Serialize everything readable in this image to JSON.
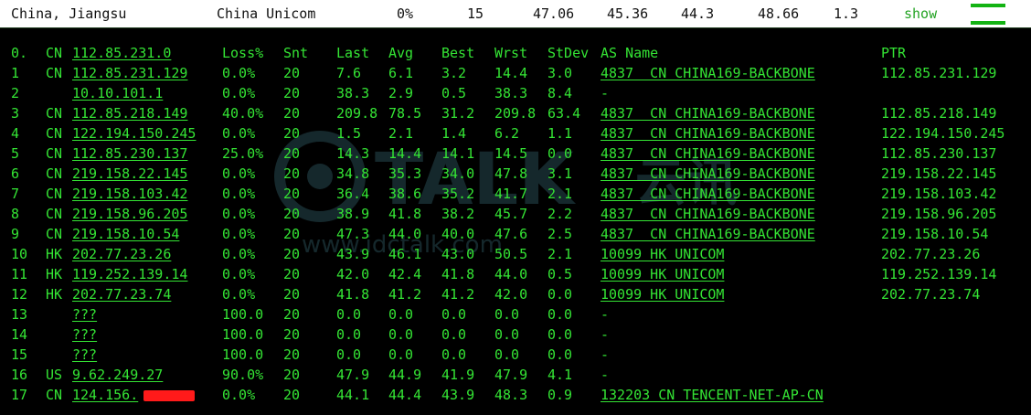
{
  "summary": {
    "location": "China, Jiangsu",
    "isp": "China Unicom",
    "loss": "0%",
    "snt": "15",
    "last": "47.06",
    "avg": "45.36",
    "best": "44.3",
    "wrst": "48.66",
    "stdev": "1.3",
    "show_label": "show"
  },
  "header": {
    "hop": "0.",
    "cc": "CN",
    "host": "112.85.231.0",
    "loss": "Loss%",
    "snt": "Snt",
    "last": "Last",
    "avg": "Avg",
    "best": "Best",
    "wrst": "Wrst",
    "stdev": "StDev",
    "asn": "AS Name",
    "ptr": "PTR"
  },
  "rows": [
    {
      "hop": "1",
      "cc": "CN",
      "host": "112.85.231.129",
      "loss": "0.0%",
      "snt": "20",
      "last": "7.6",
      "avg": "6.1",
      "best": "3.2",
      "wrst": "14.4",
      "stdev": "3.0",
      "asn": "4837  CN CHINA169-BACKBONE",
      "ptr": "112.85.231.129"
    },
    {
      "hop": "2",
      "cc": "",
      "host": "10.10.101.1",
      "loss": "0.0%",
      "snt": "20",
      "last": "38.3",
      "avg": "2.9",
      "best": "0.5",
      "wrst": "38.3",
      "stdev": "8.4",
      "asn": "-",
      "ptr": ""
    },
    {
      "hop": "3",
      "cc": "CN",
      "host": "112.85.218.149",
      "loss": "40.0%",
      "snt": "20",
      "last": "209.8",
      "avg": "78.5",
      "best": "31.2",
      "wrst": "209.8",
      "stdev": "63.4",
      "asn": "4837  CN CHINA169-BACKBONE",
      "ptr": "112.85.218.149"
    },
    {
      "hop": "4",
      "cc": "CN",
      "host": "122.194.150.245",
      "loss": "0.0%",
      "snt": "20",
      "last": "1.5",
      "avg": "2.1",
      "best": "1.4",
      "wrst": "6.2",
      "stdev": "1.1",
      "asn": "4837  CN CHINA169-BACKBONE",
      "ptr": "122.194.150.245"
    },
    {
      "hop": "5",
      "cc": "CN",
      "host": "112.85.230.137",
      "loss": "25.0%",
      "snt": "20",
      "last": "14.3",
      "avg": "14.4",
      "best": "14.1",
      "wrst": "14.5",
      "stdev": "0.0",
      "asn": "4837  CN CHINA169-BACKBONE",
      "ptr": "112.85.230.137"
    },
    {
      "hop": "6",
      "cc": "CN",
      "host": "219.158.22.145",
      "loss": "0.0%",
      "snt": "20",
      "last": "34.8",
      "avg": "35.3",
      "best": "34.0",
      "wrst": "47.8",
      "stdev": "3.1",
      "asn": "4837  CN CHINA169-BACKBONE",
      "ptr": "219.158.22.145"
    },
    {
      "hop": "7",
      "cc": "CN",
      "host": "219.158.103.42",
      "loss": "0.0%",
      "snt": "20",
      "last": "36.4",
      "avg": "38.6",
      "best": "35.2",
      "wrst": "41.7",
      "stdev": "2.1",
      "asn": "4837  CN CHINA169-BACKBONE",
      "ptr": "219.158.103.42"
    },
    {
      "hop": "8",
      "cc": "CN",
      "host": "219.158.96.205",
      "loss": "0.0%",
      "snt": "20",
      "last": "38.9",
      "avg": "41.8",
      "best": "38.2",
      "wrst": "45.7",
      "stdev": "2.2",
      "asn": "4837  CN CHINA169-BACKBONE",
      "ptr": "219.158.96.205"
    },
    {
      "hop": "9",
      "cc": "CN",
      "host": "219.158.10.54",
      "loss": "0.0%",
      "snt": "20",
      "last": "47.3",
      "avg": "44.0",
      "best": "40.0",
      "wrst": "47.6",
      "stdev": "2.5",
      "asn": "4837  CN CHINA169-BACKBONE",
      "ptr": "219.158.10.54"
    },
    {
      "hop": "10",
      "cc": "HK",
      "host": "202.77.23.26",
      "loss": "0.0%",
      "snt": "20",
      "last": "43.9",
      "avg": "46.1",
      "best": "43.0",
      "wrst": "50.5",
      "stdev": "2.1",
      "asn": "10099 HK UNICOM",
      "ptr": "202.77.23.26"
    },
    {
      "hop": "11",
      "cc": "HK",
      "host": "119.252.139.14",
      "loss": "0.0%",
      "snt": "20",
      "last": "42.0",
      "avg": "42.4",
      "best": "41.8",
      "wrst": "44.0",
      "stdev": "0.5",
      "asn": "10099 HK UNICOM",
      "ptr": "119.252.139.14"
    },
    {
      "hop": "12",
      "cc": "HK",
      "host": "202.77.23.74",
      "loss": "0.0%",
      "snt": "20",
      "last": "41.8",
      "avg": "41.2",
      "best": "41.2",
      "wrst": "42.0",
      "stdev": "0.0",
      "asn": "10099 HK UNICOM",
      "ptr": "202.77.23.74"
    },
    {
      "hop": "13",
      "cc": "",
      "host": "???",
      "loss": "100.0",
      "snt": "20",
      "last": "0.0",
      "avg": "0.0",
      "best": "0.0",
      "wrst": "0.0",
      "stdev": "0.0",
      "asn": "-",
      "ptr": ""
    },
    {
      "hop": "14",
      "cc": "",
      "host": "???",
      "loss": "100.0",
      "snt": "20",
      "last": "0.0",
      "avg": "0.0",
      "best": "0.0",
      "wrst": "0.0",
      "stdev": "0.0",
      "asn": "-",
      "ptr": ""
    },
    {
      "hop": "15",
      "cc": "",
      "host": "???",
      "loss": "100.0",
      "snt": "20",
      "last": "0.0",
      "avg": "0.0",
      "best": "0.0",
      "wrst": "0.0",
      "stdev": "0.0",
      "asn": "-",
      "ptr": ""
    },
    {
      "hop": "16",
      "cc": "US",
      "host": "9.62.249.27",
      "loss": "90.0%",
      "snt": "20",
      "last": "47.9",
      "avg": "44.9",
      "best": "41.9",
      "wrst": "47.9",
      "stdev": "4.1",
      "asn": "-",
      "ptr": ""
    },
    {
      "hop": "17",
      "cc": "CN",
      "host": "124.156.",
      "loss": "0.0%",
      "snt": "20",
      "last": "44.1",
      "avg": "44.4",
      "best": "43.9",
      "wrst": "48.3",
      "stdev": "0.9",
      "asn": "132203 CN TENCENT-NET-AP-CN",
      "ptr": "",
      "redacted": true
    }
  ],
  "watermark": {
    "brand": "TALK",
    "brand_cn": "云讯",
    "url": "www.idctalk.com"
  },
  "colors": {
    "terminal_bg": "#000000",
    "terminal_text": "#34e434",
    "show_link": "#23a323",
    "status_bar": "#13b313",
    "redaction": "#ff1a1a"
  }
}
